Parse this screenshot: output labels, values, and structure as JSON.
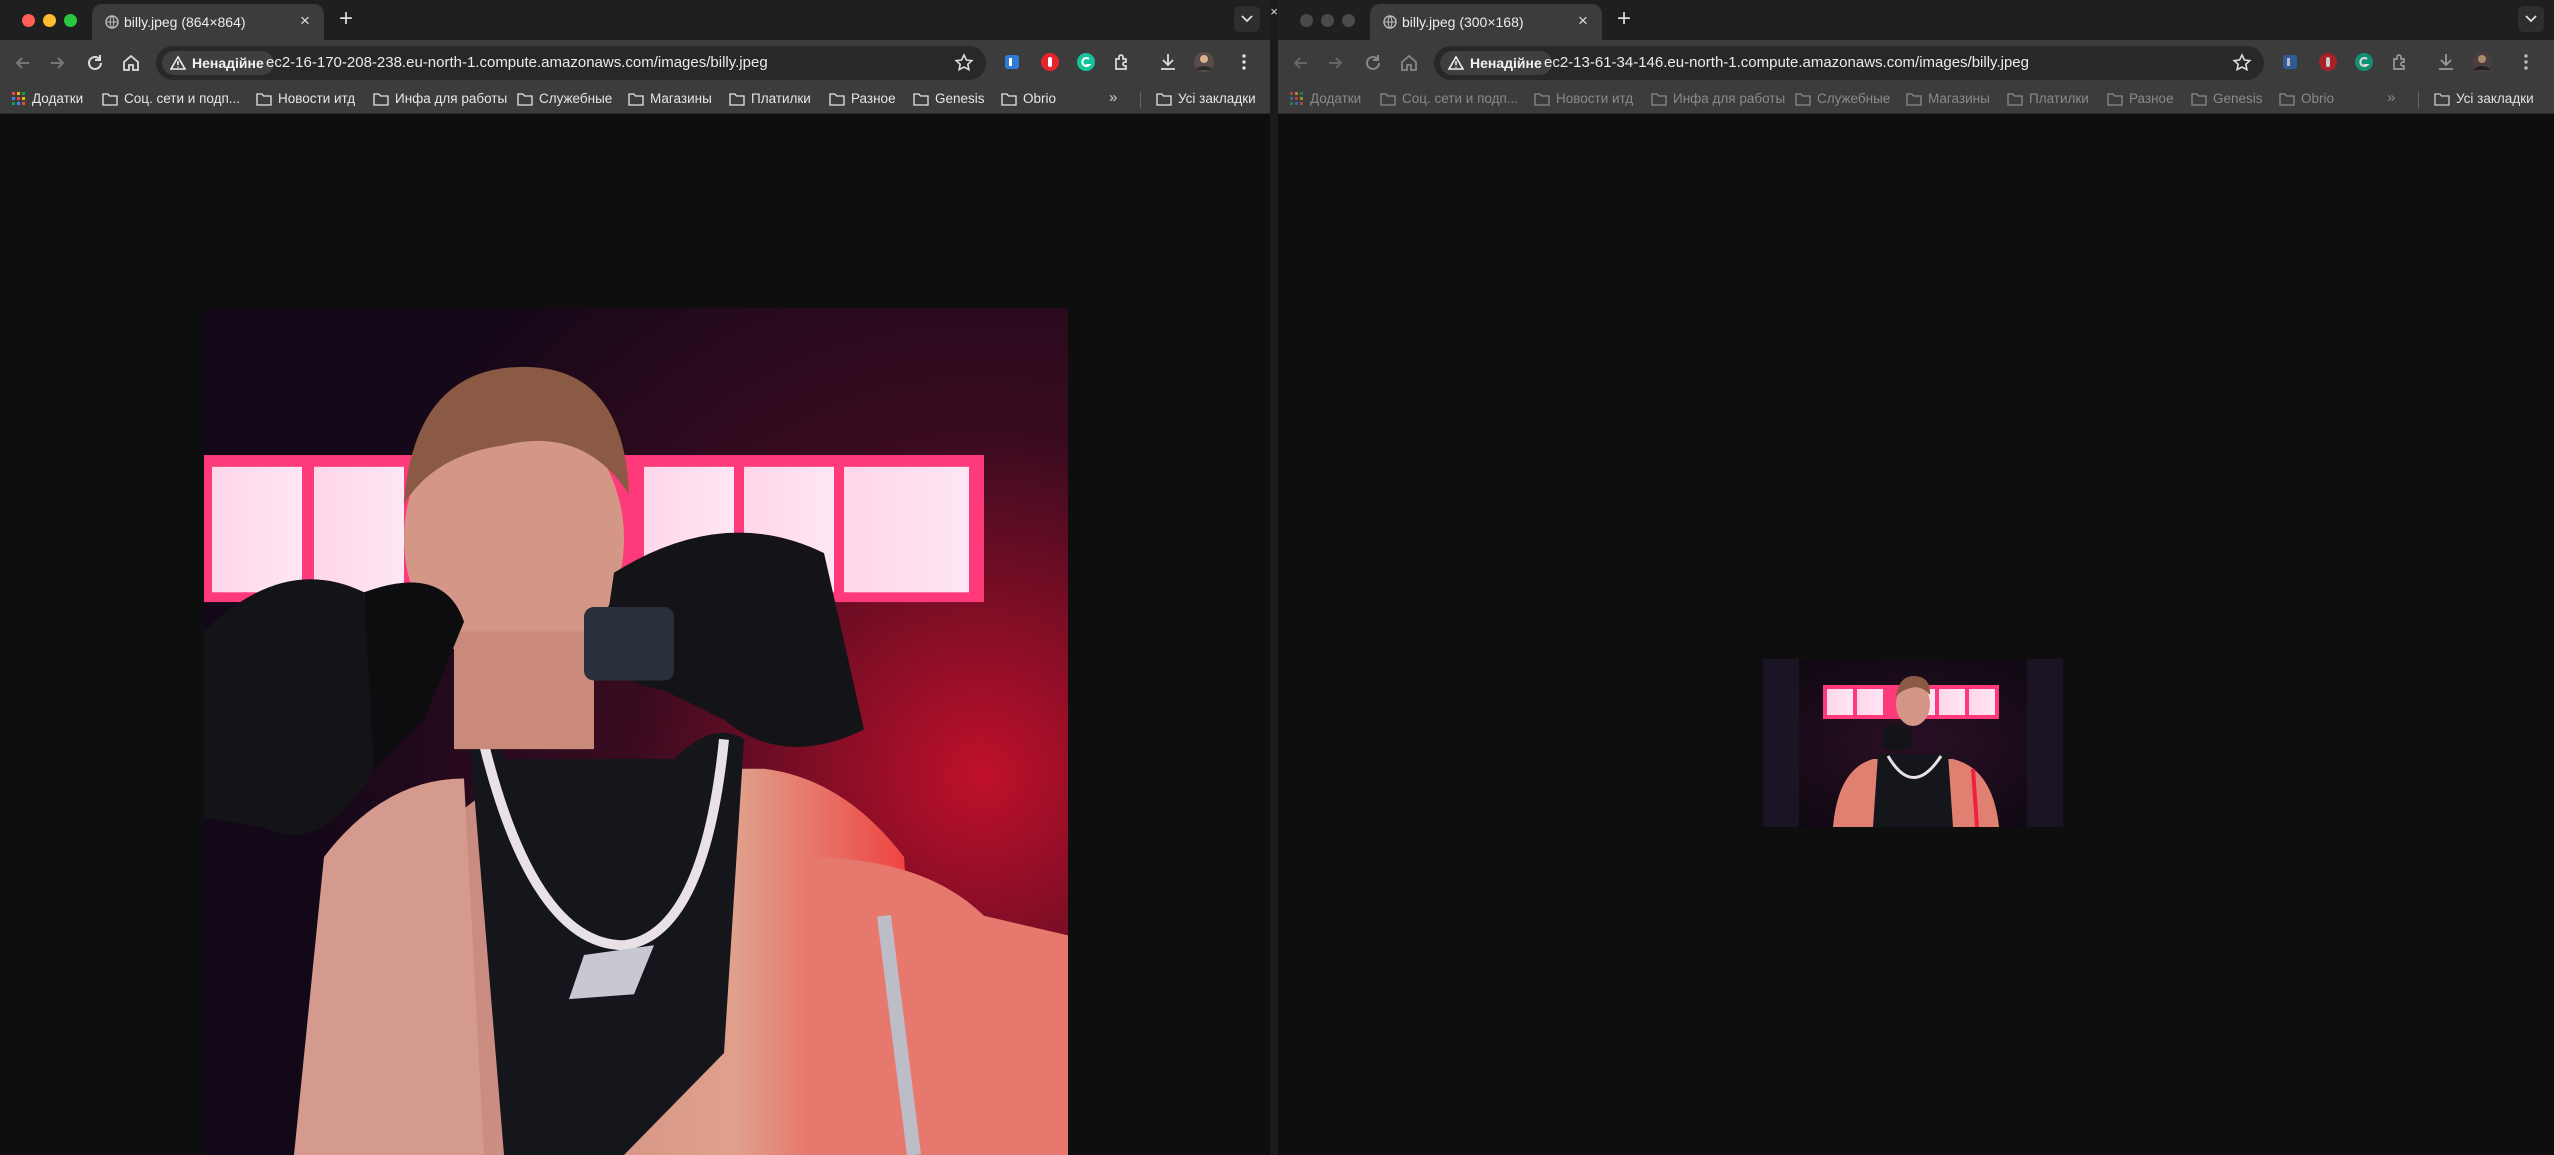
{
  "left_window": {
    "tab": {
      "title": "billy.jpeg (864×864)"
    },
    "security_label": "Ненадійне",
    "url": "ec2-16-170-208-238.eu-north-1.compute.amazonaws.com/images/billy.jpeg",
    "bookmarks": [
      "Додатки",
      "Соц. сети и подп...",
      "Новости итд",
      "Инфа для работы",
      "Служебные",
      "Магазины",
      "Платилки",
      "Разное",
      "Genesis",
      "Obrio"
    ],
    "all_bookmarks": "Усі закладки"
  },
  "right_window": {
    "tab": {
      "title": "billy.jpeg (300×168)"
    },
    "security_label": "Ненадійне",
    "url": "ec2-13-61-34-146.eu-north-1.compute.amazonaws.com/images/billy.jpeg",
    "bookmarks": [
      "Додатки",
      "Соц. сети и подп...",
      "Новости итд",
      "Инфа для работы",
      "Служебные",
      "Магазины",
      "Платилки",
      "Разное",
      "Genesis",
      "Obrio"
    ],
    "all_bookmarks": "Усі закладки"
  },
  "colors": {
    "close_light": "#ff5f57",
    "minimize_light": "#febc2e",
    "maximize_light": "#28c840",
    "inactive_light": "#4a4a4a",
    "ext_red": "#e8232b",
    "ext_green": "#15c39a",
    "ext_blue": "#2f7bd8"
  }
}
